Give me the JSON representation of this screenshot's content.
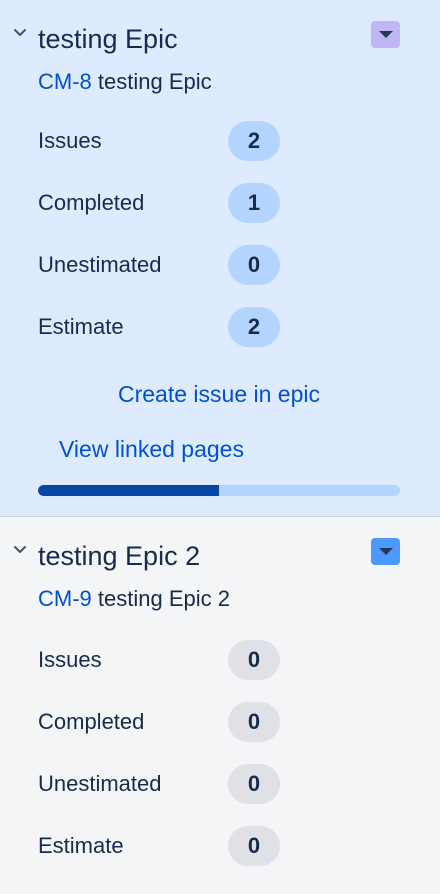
{
  "epics": [
    {
      "title": "testing Epic",
      "key": "CM-8",
      "summary": "testing Epic",
      "menu_color": "#c0b6f2",
      "stats": [
        {
          "label": "Issues",
          "value": "2"
        },
        {
          "label": "Completed",
          "value": "1"
        },
        {
          "label": "Unestimated",
          "value": "0"
        },
        {
          "label": "Estimate",
          "value": "2"
        }
      ],
      "create_issue_label": "Create issue in epic",
      "view_pages_label": "View linked pages",
      "progress_fraction": 0.5
    },
    {
      "title": "testing Epic 2",
      "key": "CM-9",
      "summary": "testing Epic 2",
      "menu_color": "#4c9aff",
      "stats": [
        {
          "label": "Issues",
          "value": "0"
        },
        {
          "label": "Completed",
          "value": "0"
        },
        {
          "label": "Unestimated",
          "value": "0"
        },
        {
          "label": "Estimate",
          "value": "0"
        }
      ]
    }
  ]
}
